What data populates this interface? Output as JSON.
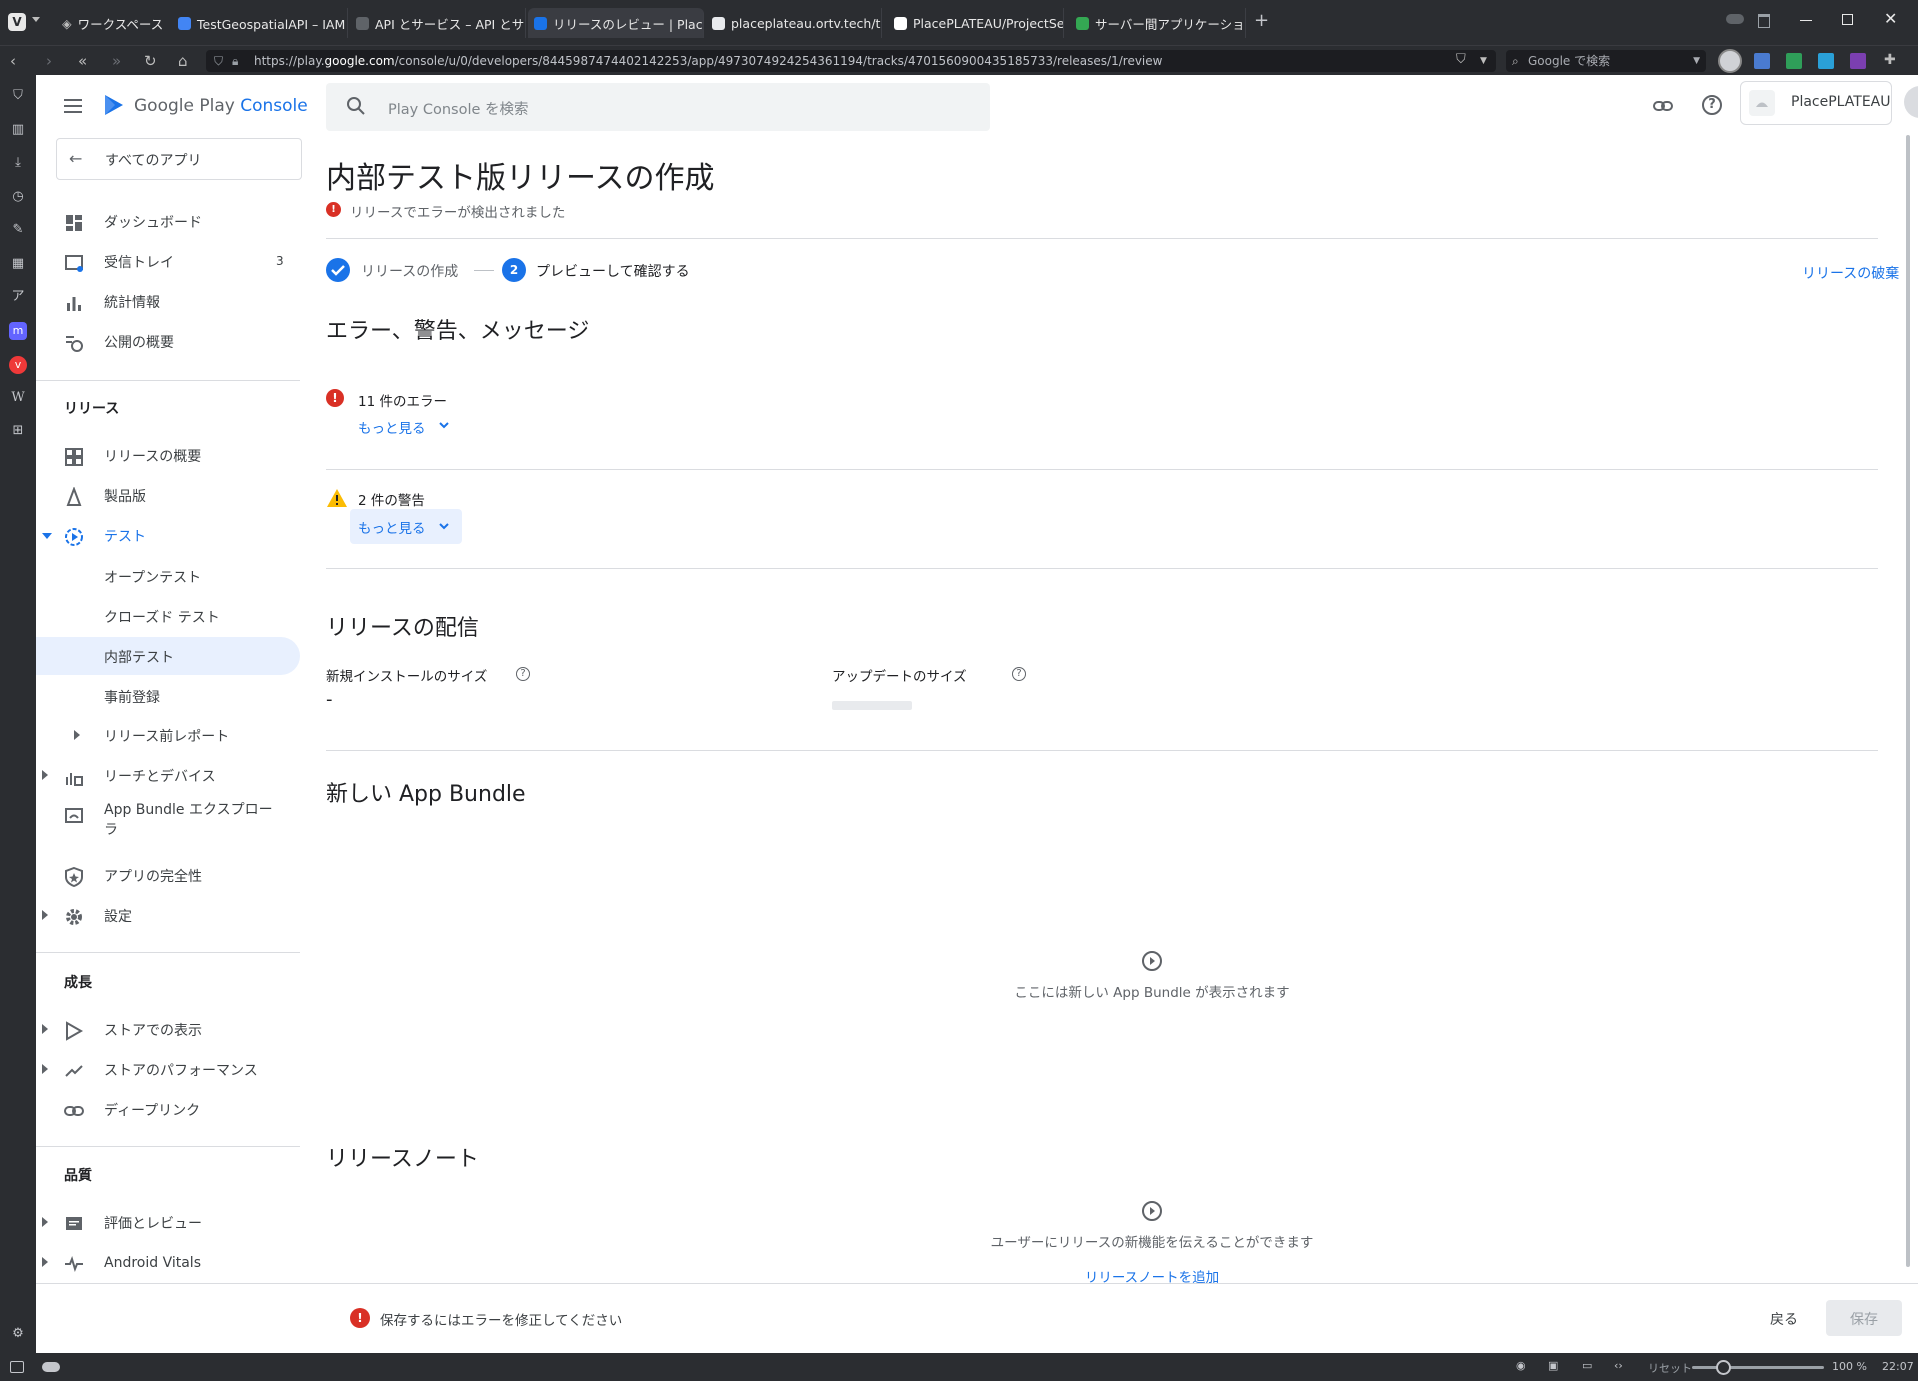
{
  "browser": {
    "workspace_label": "ワークスペース",
    "tabs": [
      {
        "title": "TestGeospatialAPI – IAM と管",
        "color": "#4285f4"
      },
      {
        "title": "API とサービス – API とサービス",
        "color": "#5f6368"
      },
      {
        "title": "リリースのレビュー | PlacePLATEAU",
        "color": "#1a73e8",
        "active": true
      },
      {
        "title": "placeplateau.ortv.tech/token",
        "color": "#e8eaed"
      },
      {
        "title": "PlacePLATEAU/ProjectSetting",
        "color": "#ffffff"
      },
      {
        "title": "サーバー間アプリケーションに OAuth",
        "color": "#34a853"
      }
    ],
    "new_tab": "+",
    "url_prefix": "https://play.",
    "url_host": "google.com",
    "url_path": "/console/u/0/developers/8445987474402142253/app/4973074924254361194/tracks/4701560900435185733/releases/1/review",
    "search_placeholder": "Google で検索",
    "status": {
      "reset": "リセット",
      "zoom": "100 %",
      "time": "22:07"
    }
  },
  "console": {
    "logo_google": "Google Play",
    "logo_console": "Console",
    "search_placeholder": "Play Console を検索",
    "account_name": "PlacePLATEAU"
  },
  "sidenav": {
    "all_apps": "すべてのアプリ",
    "top_items": [
      {
        "label": "ダッシュボード",
        "icon": "dashboard-icon"
      },
      {
        "label": "受信トレイ",
        "icon": "inbox-icon",
        "badge": "3"
      },
      {
        "label": "統計情報",
        "icon": "bar-chart-icon"
      },
      {
        "label": "公開の概要",
        "icon": "publishing-overview-icon"
      }
    ],
    "release_section": "リリース",
    "release_items": [
      {
        "label": "リリースの概要"
      },
      {
        "label": "製品版"
      },
      {
        "label": "テスト"
      }
    ],
    "test_subitems": [
      "オープンテスト",
      "クローズド テスト",
      "内部テスト",
      "事前登録"
    ],
    "release_more": [
      {
        "label": "リリース前レポート"
      },
      {
        "label": "リーチとデバイス"
      },
      {
        "label": "App Bundle エクスプロー",
        "label2": "ラ"
      },
      {
        "label": "アプリの完全性"
      },
      {
        "label": "設定"
      }
    ],
    "growth_section": "成長",
    "growth_items": [
      {
        "label": "ストアでの表示"
      },
      {
        "label": "ストアのパフォーマンス"
      },
      {
        "label": "ディープリンク"
      }
    ],
    "quality_section": "品質",
    "quality_items": [
      {
        "label": "評価とレビュー"
      },
      {
        "label": "Android Vitals"
      }
    ]
  },
  "main": {
    "page_title": "内部テスト版リリースの作成",
    "error_banner": "リリースでエラーが検出されました",
    "steps": {
      "step1": "リリースの作成",
      "step2_num": "2",
      "step2": "プレビューして確認する"
    },
    "discard_link": "リリースの破棄",
    "messages_heading": "エラー、警告、メッセージ",
    "errors_label": "11 件のエラー",
    "warnings_label": "2 件の警告",
    "more_label": "もっと見る",
    "delivery_heading": "リリースの配信",
    "install_size_label": "新規インストールのサイズ",
    "install_size_value": "-",
    "update_size_label": "アップデートのサイズ",
    "bundle_heading": "新しい App Bundle",
    "bundle_empty": "ここには新しい App Bundle が表示されます",
    "notes_heading": "リリースノート",
    "notes_empty": "ユーザーにリリースの新機能を伝えることができます",
    "notes_add": "リリースノートを追加",
    "footer_error": "保存するにはエラーを修正してください",
    "back_button": "戻る",
    "save_button": "保存"
  },
  "colors": {
    "accent": "#1a73e8",
    "error": "#d93025",
    "warning": "#fbbc04",
    "selected_bg": "#e8f0fe"
  }
}
